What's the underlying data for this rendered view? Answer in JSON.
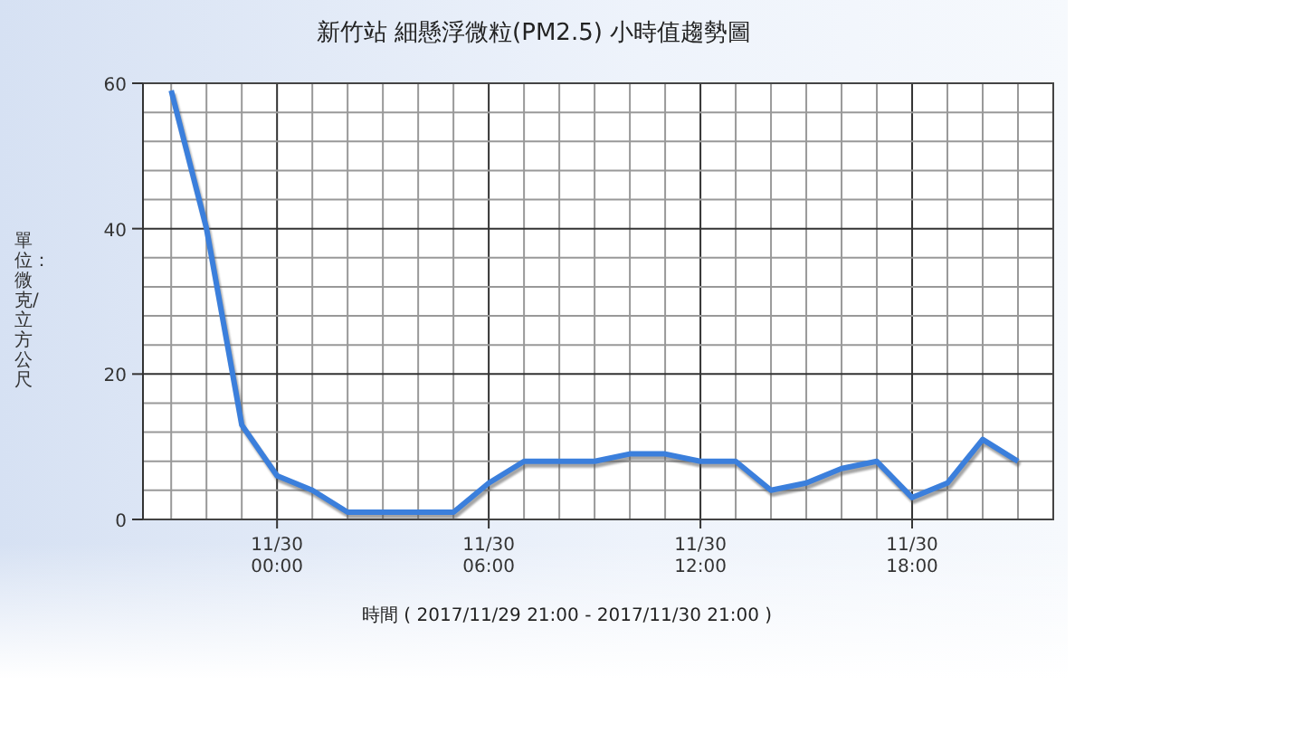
{
  "chart": {
    "chart_data": {
      "type": "line",
      "title": "新竹站  細懸浮微粒(PM2.5) 小時值趨勢圖",
      "xlabel": "時間 ( 2017/11/29 21:00 - 2017/11/30 21:00 )",
      "ylabel": "單位：微克/立方公尺",
      "categories": [
        null,
        null,
        null,
        "11/30 00:00",
        null,
        null,
        null,
        null,
        null,
        "11/30 06:00",
        null,
        null,
        null,
        null,
        null,
        "11/30 12:00",
        null,
        null,
        null,
        null,
        null,
        "11/30 18:00",
        null,
        null,
        null
      ],
      "series": [
        {
          "color": "#3b7fdc",
          "values": [
            59,
            40,
            13,
            6,
            4,
            1,
            1,
            1,
            1,
            5,
            8,
            8,
            8,
            9,
            9,
            8,
            8,
            4,
            5,
            7,
            8,
            3,
            5,
            11,
            8
          ]
        }
      ],
      "ylim": [
        0,
        60
      ],
      "grid": true,
      "yticks": [
        0,
        20,
        40,
        60
      ]
    }
  }
}
